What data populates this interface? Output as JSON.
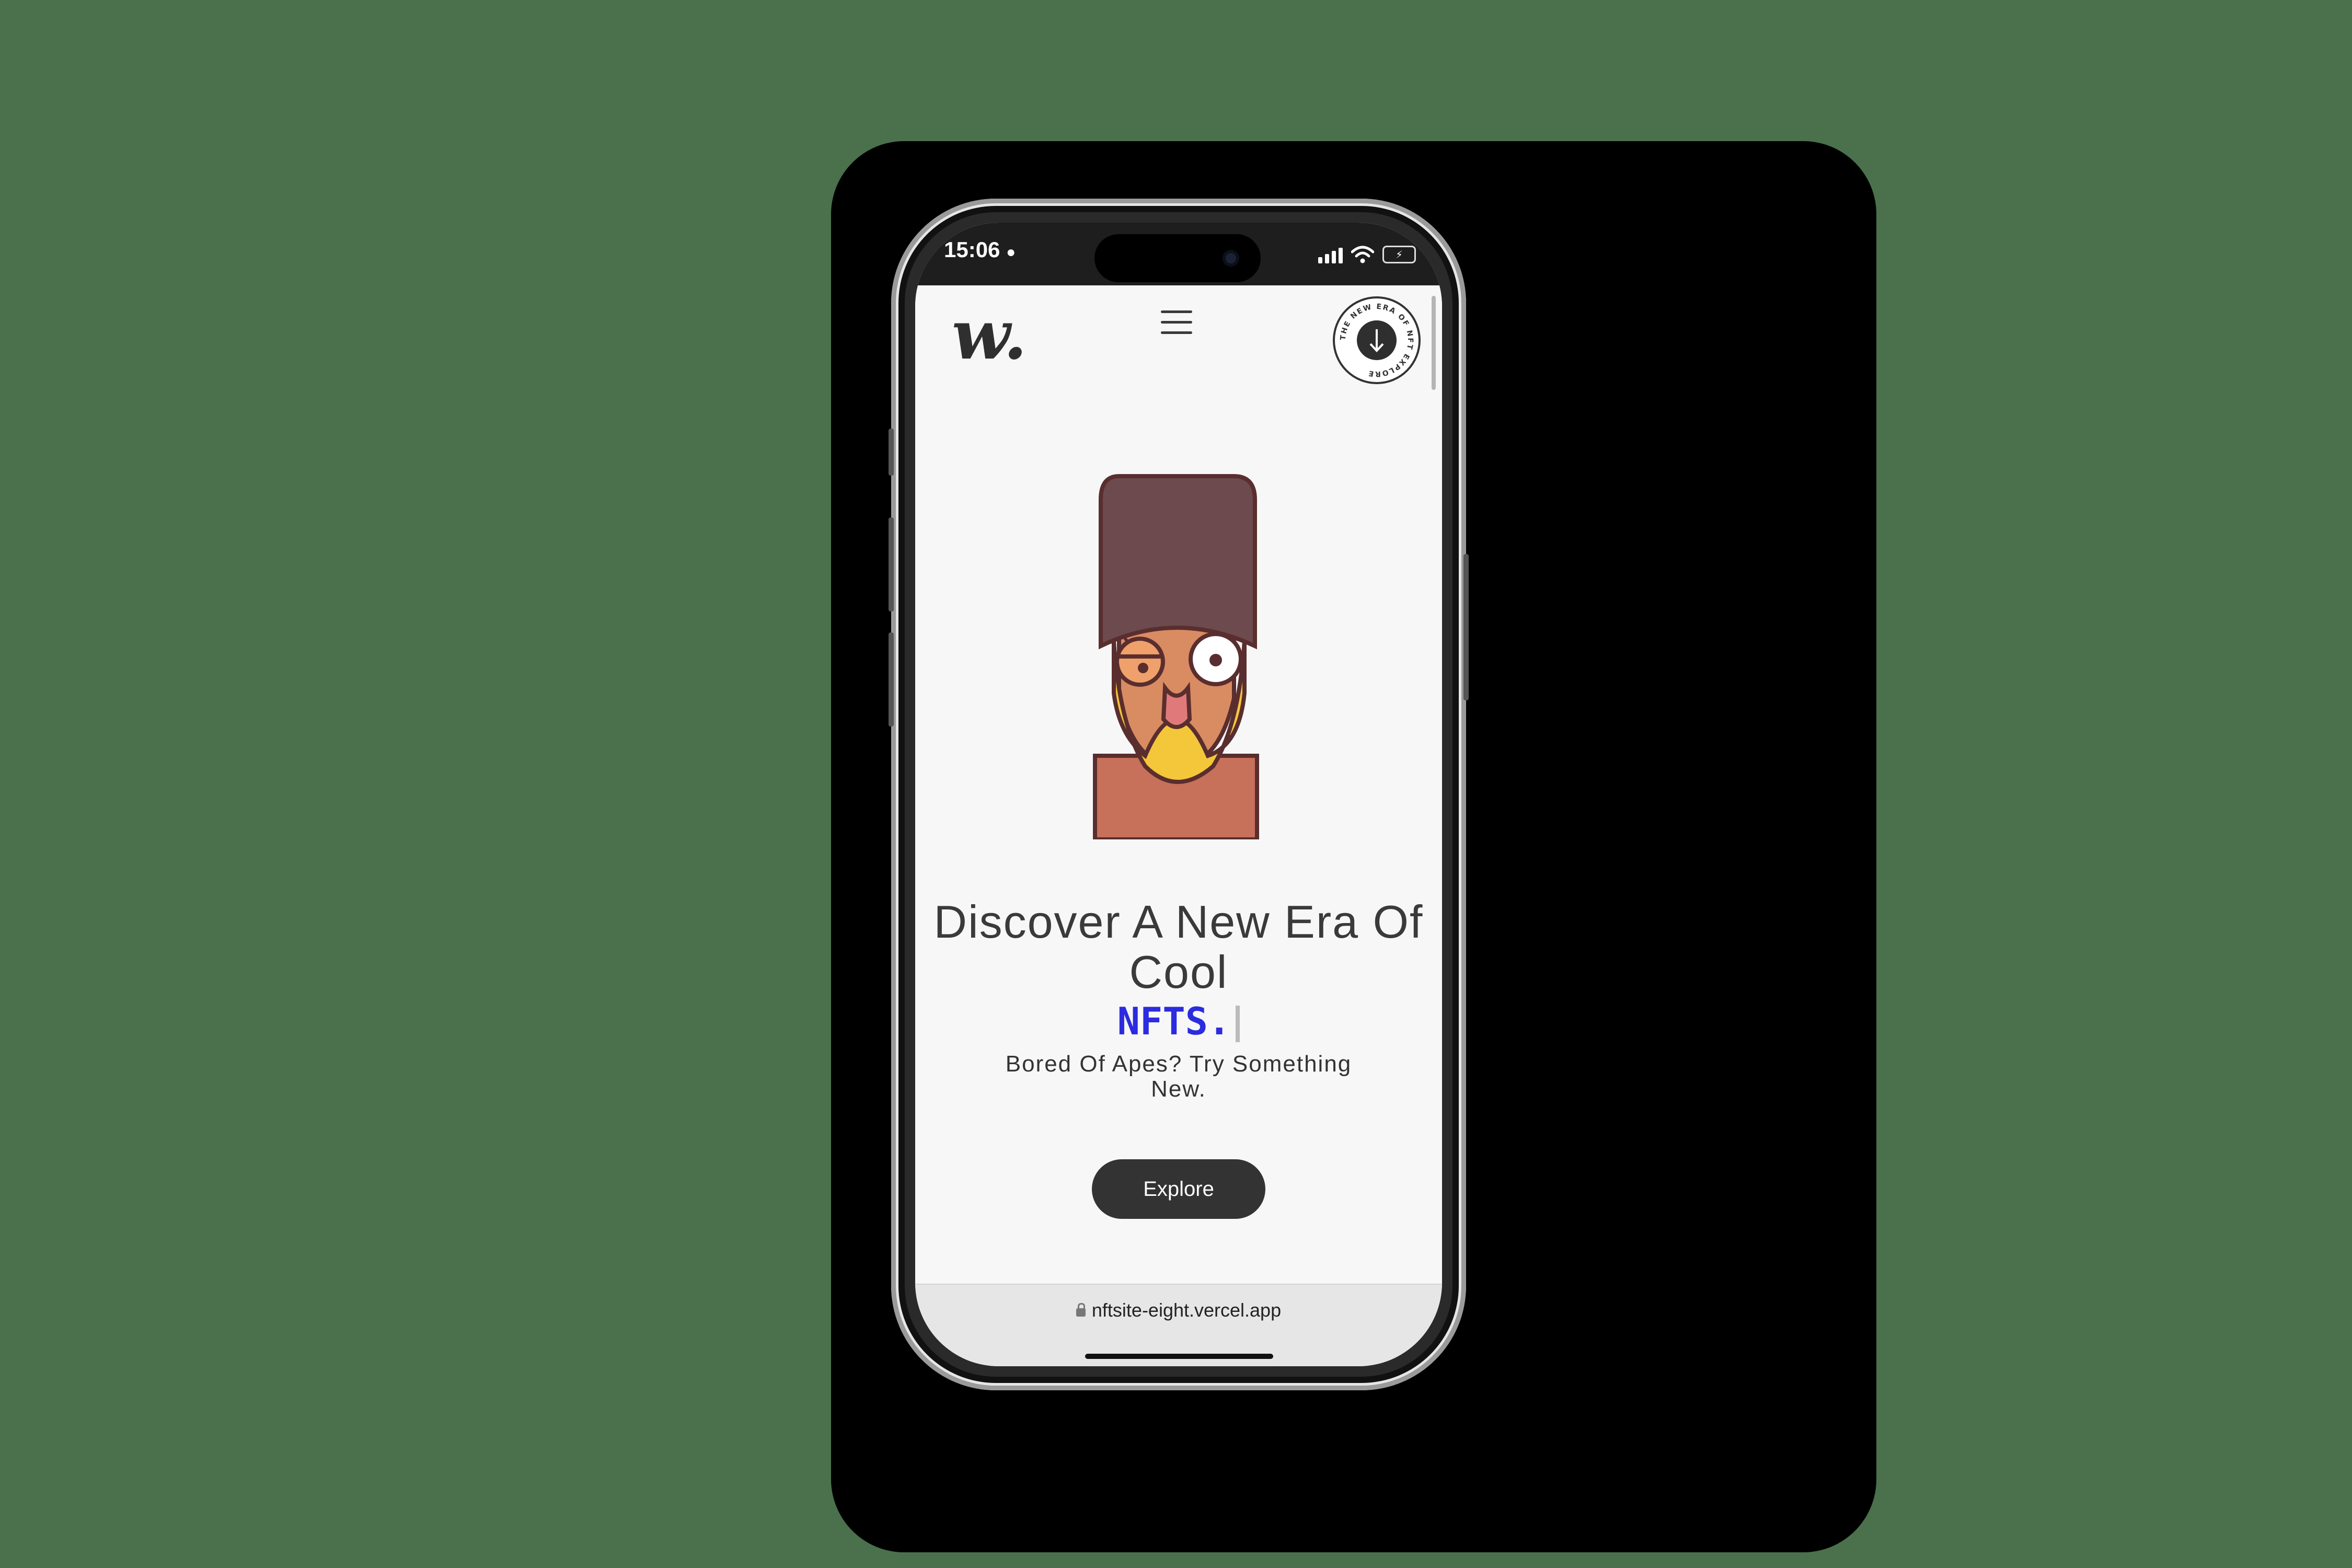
{
  "status_bar": {
    "time": "15:06",
    "battery": "⚡"
  },
  "site": {
    "logo": "w.",
    "badge": {
      "ring_text": "THE NEW ERA OF NFT EXPLORE",
      "icon": "arrow-down-icon"
    },
    "headline": "Discover A New Era Of Cool",
    "typed_word": "NFTS.",
    "subheadline": "Bored Of Apes? Try Something New.",
    "cta_label": "Explore"
  },
  "browser": {
    "url": "nftsite-eight.vercel.app"
  },
  "colors": {
    "accent": "#2b2be0",
    "button": "#333333",
    "background": "#4a714c"
  }
}
